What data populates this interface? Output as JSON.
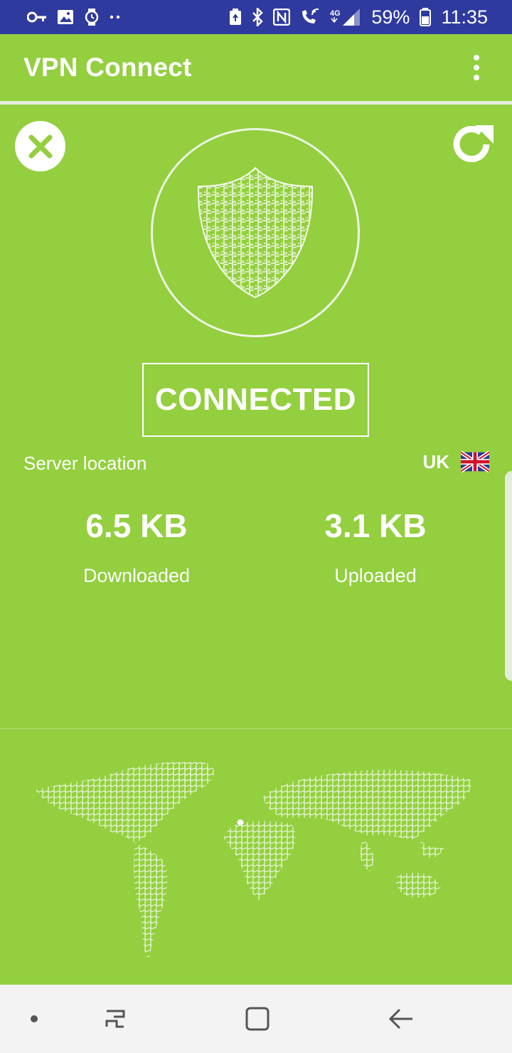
{
  "status_bar": {
    "battery": "59%",
    "time": "11:35",
    "network": "4G",
    "icons": [
      "vpn-key-icon",
      "gallery-icon",
      "watch-icon",
      "more-dots-icon",
      "nfc-icon",
      "bluetooth-icon",
      "wifi-call-icon",
      "signal-icon",
      "battery-icon"
    ]
  },
  "app_bar": {
    "title": "VPN Connect",
    "menu_icon": "more-vert-icon"
  },
  "controls": {
    "disconnect_icon": "close-icon",
    "refresh_icon": "refresh-icon"
  },
  "connection": {
    "status": "CONNECTED",
    "shield_icon": "shield-icon",
    "server_location_label": "Server location",
    "country": "UK",
    "flag_icon": "uk-flag-icon"
  },
  "stats": {
    "downloaded_value": "6.5 KB",
    "downloaded_label": "Downloaded",
    "uploaded_value": "3.1 KB",
    "uploaded_label": "Uploaded"
  },
  "nav_bar": {
    "items": [
      "dot-icon",
      "recent-apps-icon",
      "home-icon",
      "back-icon"
    ]
  },
  "colors": {
    "background": "#93cf3e",
    "status_bar": "#2f3a9e",
    "accent": "#ffffff"
  }
}
